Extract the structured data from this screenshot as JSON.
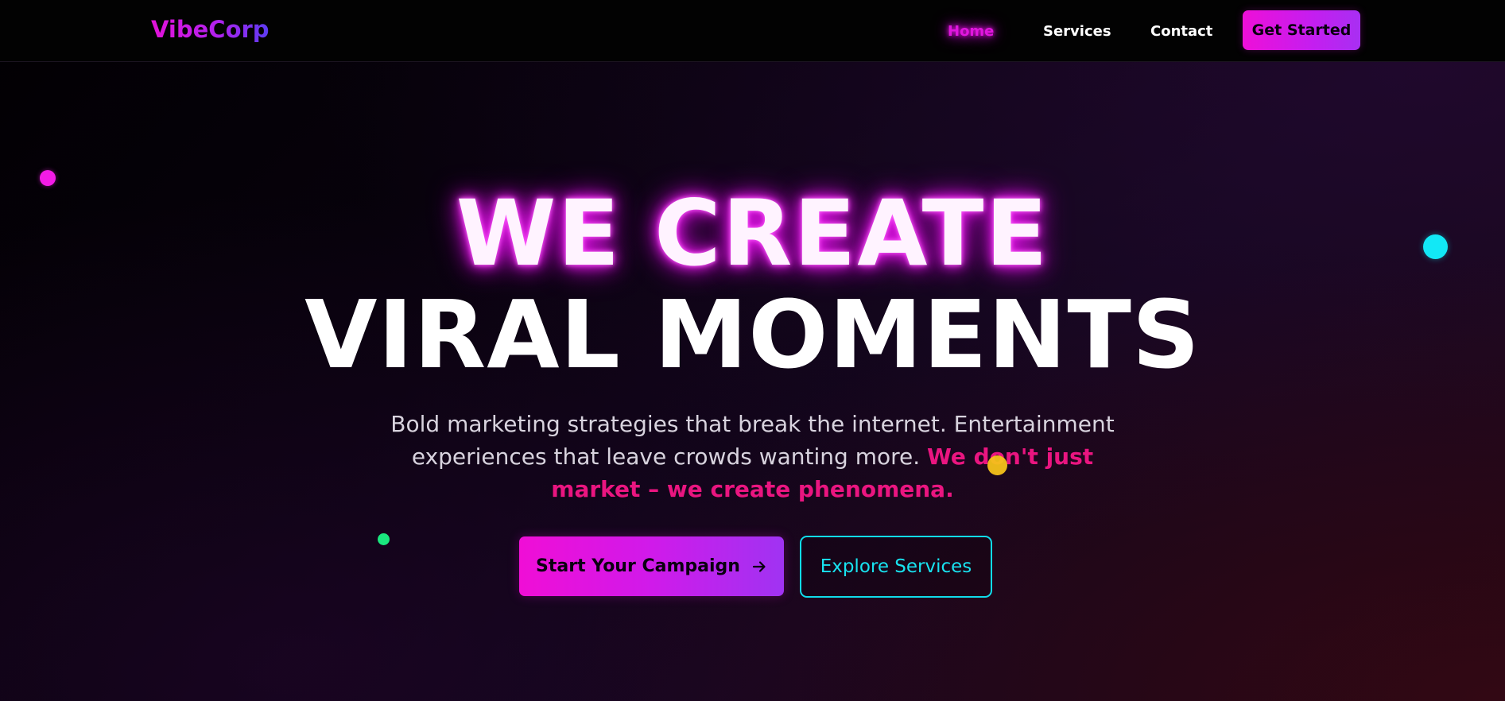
{
  "brand": {
    "logo": "VibeCorp"
  },
  "nav": {
    "links": [
      {
        "label": "Home",
        "active": true
      },
      {
        "label": "Services",
        "active": false
      },
      {
        "label": "Contact",
        "active": false
      }
    ],
    "cta": "Get Started"
  },
  "hero": {
    "headline_line1": "WE CREATE",
    "headline_line2": "VIRAL MOMENTS",
    "subtitle_plain": "Bold marketing strategies that break the internet. Entertainment experiences that leave crowds wanting more. ",
    "subtitle_accent": "We don't just market – we create phenomena.",
    "primary_button": "Start Your Campaign",
    "primary_button_icon": "arrow-right-icon",
    "secondary_button": "Explore Services"
  },
  "colors": {
    "accent_magenta": "#e116df",
    "accent_pink": "#ea1580",
    "accent_cyan": "#10dceb",
    "accent_green": "#1ae87f",
    "accent_yellow": "#f5c21a",
    "background": "#000000"
  }
}
